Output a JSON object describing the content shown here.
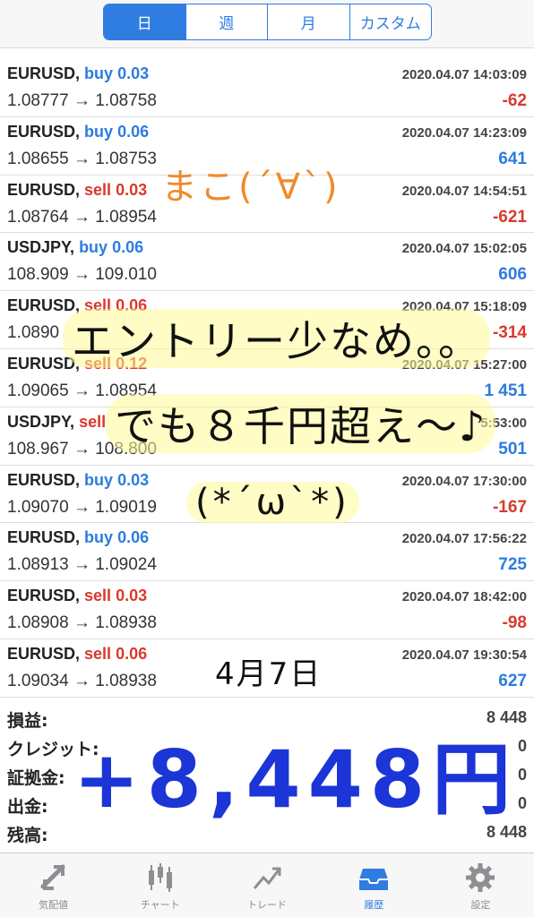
{
  "tabs": [
    {
      "label": "日",
      "active": true
    },
    {
      "label": "週",
      "active": false
    },
    {
      "label": "月",
      "active": false
    },
    {
      "label": "カスタム",
      "active": false
    }
  ],
  "trades": [
    {
      "symbol": "EURUSD,",
      "direction": "buy",
      "lot": "0.03",
      "time": "2020.04.07 14:03:09",
      "prices": "1.08777 → 1.08758",
      "profit": "-62",
      "profit_sign": "neg"
    },
    {
      "symbol": "EURUSD,",
      "direction": "buy",
      "lot": "0.06",
      "time": "2020.04.07 14:23:09",
      "prices": "1.08655 → 1.08753",
      "profit": "641",
      "profit_sign": "pos"
    },
    {
      "symbol": "EURUSD,",
      "direction": "sell",
      "lot": "0.03",
      "time": "2020.04.07 14:54:51",
      "prices": "1.08764 → 1.08954",
      "profit": "-621",
      "profit_sign": "neg"
    },
    {
      "symbol": "USDJPY,",
      "direction": "buy",
      "lot": "0.06",
      "time": "2020.04.07 15:02:05",
      "prices": "108.909 → 109.010",
      "profit": "606",
      "profit_sign": "pos"
    },
    {
      "symbol": "EURUSD,",
      "direction": "sell",
      "lot": "0.06",
      "time": "2020.04.07 15:18:09",
      "prices": "1.0890",
      "profit": "-314",
      "profit_sign": "neg"
    },
    {
      "symbol": "EURUSD,",
      "direction": "sell",
      "lot": "0.12",
      "time": "2020.04.07 15:27:00",
      "prices": "1.09065 → 1.08954",
      "profit": "1 451",
      "profit_sign": "pos"
    },
    {
      "symbol": "USDJPY,",
      "direction": "sell",
      "lot": "",
      "time": "5:53:00",
      "prices": "108.967 → 108.800",
      "profit": "501",
      "profit_sign": "pos"
    },
    {
      "symbol": "EURUSD,",
      "direction": "buy",
      "lot": "0.03",
      "time": "2020.04.07 17:30:00",
      "prices": "1.09070 → 1.09019",
      "profit": "-167",
      "profit_sign": "neg"
    },
    {
      "symbol": "EURUSD,",
      "direction": "buy",
      "lot": "0.06",
      "time": "2020.04.07 17:56:22",
      "prices": "1.08913 → 1.09024",
      "profit": "725",
      "profit_sign": "pos"
    },
    {
      "symbol": "EURUSD,",
      "direction": "sell",
      "lot": "0.03",
      "time": "2020.04.07 18:42:00",
      "prices": "1.08908 → 1.08938",
      "profit": "-98",
      "profit_sign": "neg"
    },
    {
      "symbol": "EURUSD,",
      "direction": "sell",
      "lot": "0.06",
      "time": "2020.04.07 19:30:54",
      "prices": "1.09034 → 1.08938",
      "profit": "627",
      "profit_sign": "pos"
    }
  ],
  "summary": [
    {
      "label": "損益:",
      "value": "8 448"
    },
    {
      "label": "クレジット:",
      "value": "0"
    },
    {
      "label": "証拠金:",
      "value": "0"
    },
    {
      "label": "出金:",
      "value": "0"
    },
    {
      "label": "残高:",
      "value": "8 448"
    }
  ],
  "nav": [
    {
      "label": "気配値",
      "icon": "quotes-icon",
      "active": false
    },
    {
      "label": "チャート",
      "icon": "chart-icon",
      "active": false
    },
    {
      "label": "トレード",
      "icon": "trade-icon",
      "active": false
    },
    {
      "label": "履歴",
      "icon": "history-icon",
      "active": true
    },
    {
      "label": "設定",
      "icon": "settings-icon",
      "active": false
    }
  ],
  "overlays": {
    "maco": "まこ(´∀`)",
    "entry": "エントリー少なめ。。",
    "demo": "でも８千円超え〜♪",
    "face": "(*´ω`*)",
    "date": "4月7日",
    "total": "+8,448円"
  },
  "colors": {
    "accent": "#2f7de1",
    "buy": "#2d7be0",
    "sell": "#d83a2c",
    "overlay_orange": "#f08a2c",
    "overlay_blue": "#1b35d6"
  }
}
